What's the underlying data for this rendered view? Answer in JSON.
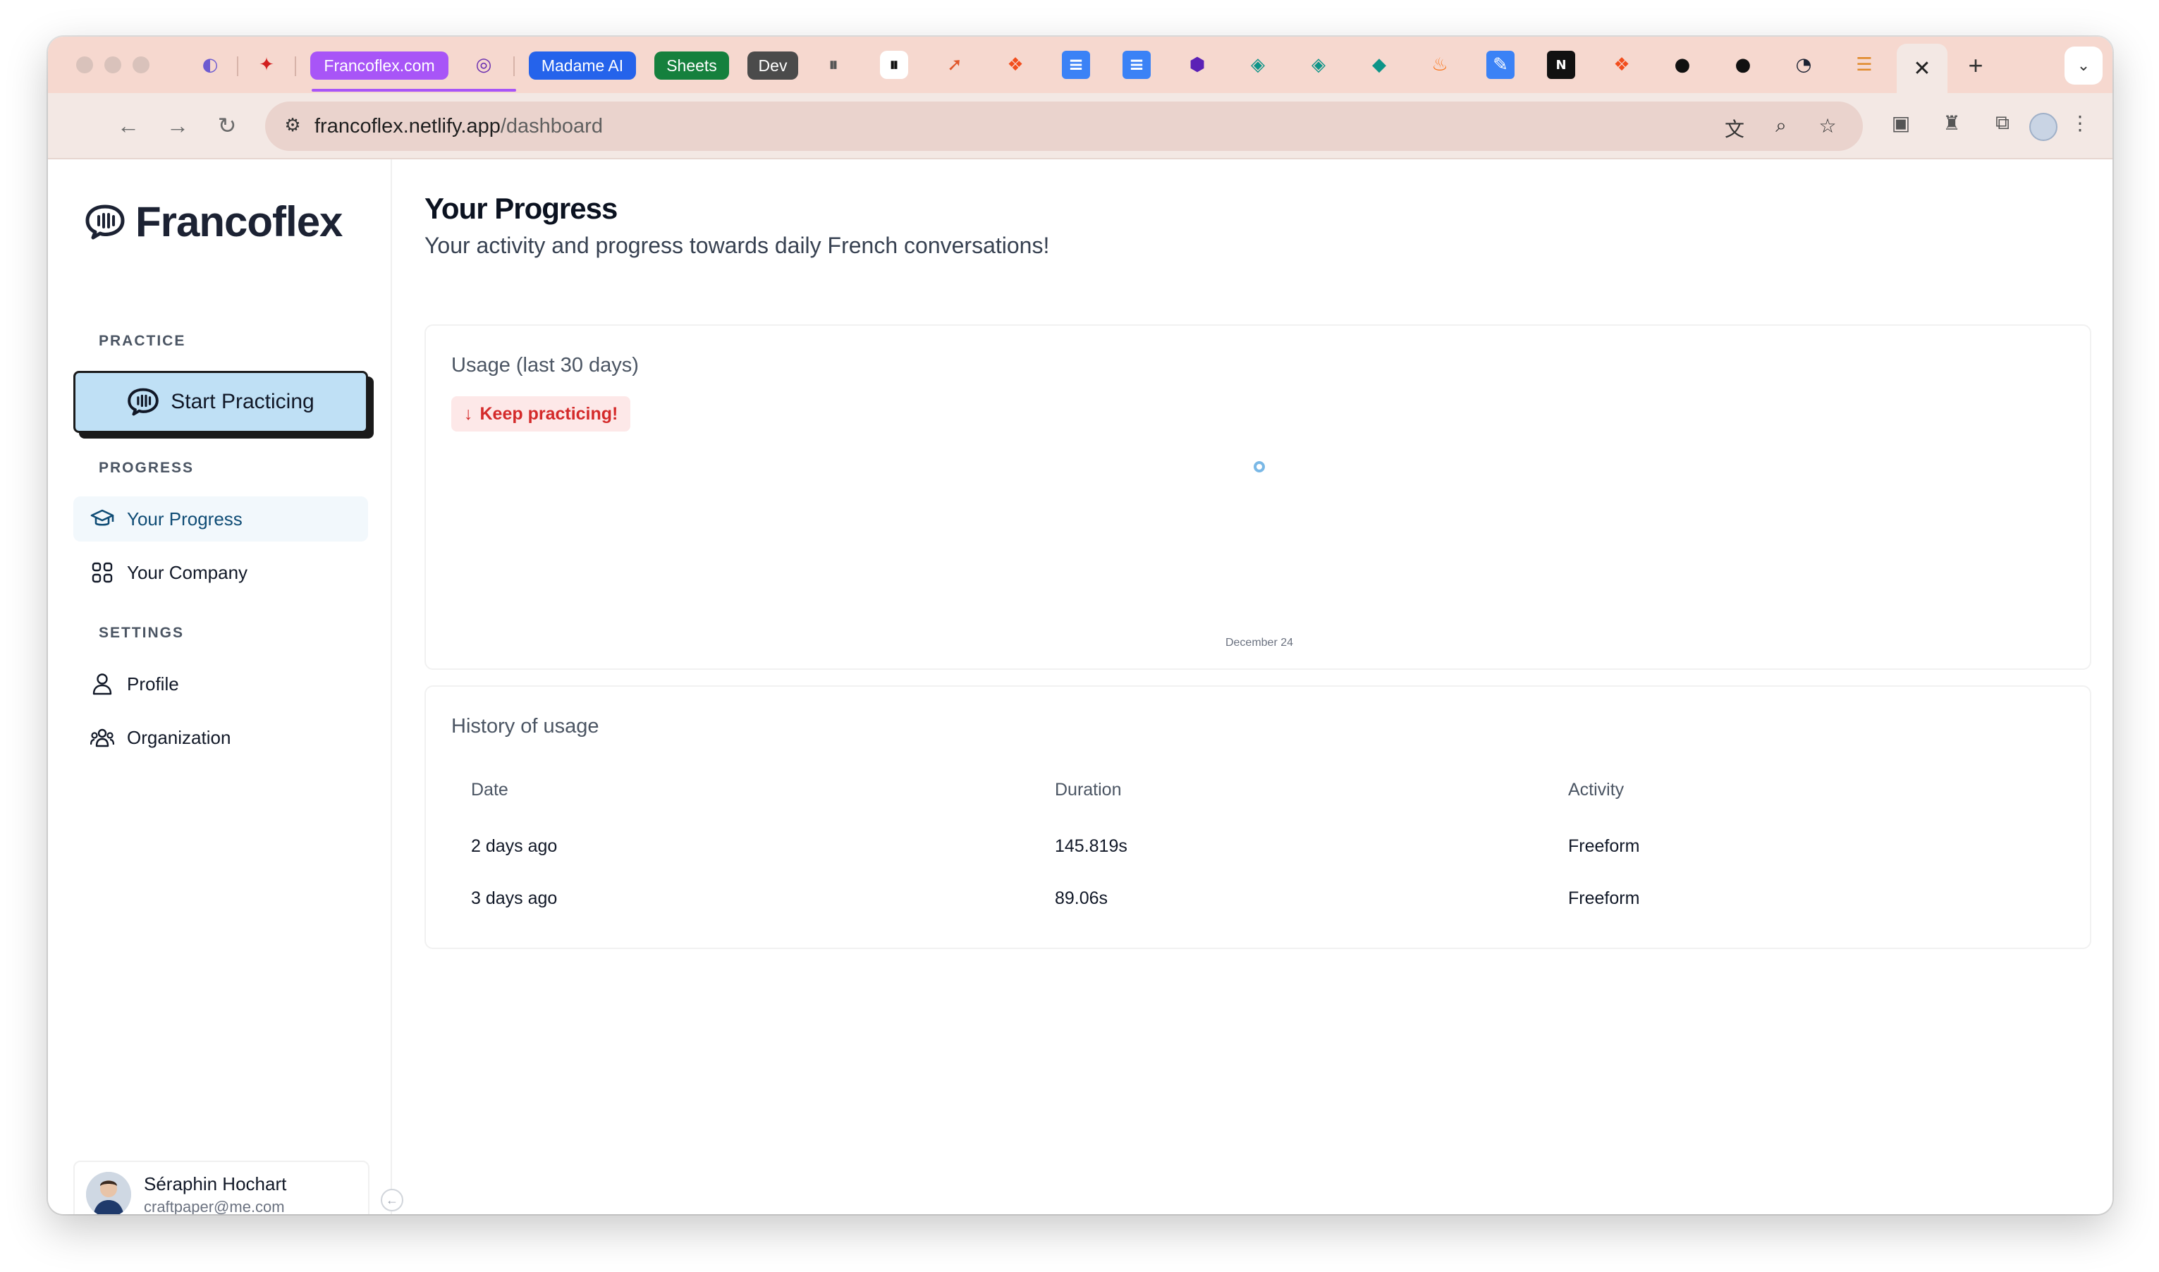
{
  "browser": {
    "tabs": {
      "francoflex": "Francoflex.com",
      "madame_ai": "Madame AI",
      "sheets": "Sheets",
      "dev": "Dev"
    },
    "url_host": "francoflex.netlify.app",
    "url_path": "/dashboard",
    "colors": {
      "tab_strip": "#f6d8cf",
      "francoflex_tab": "#a855f7",
      "madame_ai_tab": "#2563eb",
      "sheets_tab": "#15803d",
      "dev_tab": "#4b4b4b"
    }
  },
  "sidebar": {
    "brand": "Francoflex",
    "practice_label": "PRACTICE",
    "start_button": "Start Practicing",
    "progress_label": "PROGRESS",
    "progress_items": [
      {
        "label": "Your Progress",
        "active": true
      },
      {
        "label": "Your Company",
        "active": false
      }
    ],
    "settings_label": "SETTINGS",
    "settings_items": [
      {
        "label": "Profile"
      },
      {
        "label": "Organization"
      }
    ],
    "user": {
      "name": "Séraphin Hochart",
      "email": "craftpaper@me.com"
    }
  },
  "main": {
    "title": "Your Progress",
    "subtitle": "Your activity and progress towards daily French conversations!",
    "usage_card": {
      "title": "Usage (last 30 days)",
      "badge": "Keep practicing!"
    },
    "history_card": {
      "title": "History of usage",
      "columns": [
        "Date",
        "Duration",
        "Activity"
      ],
      "rows": [
        [
          "2 days ago",
          "145.819s",
          "Freeform"
        ],
        [
          "3 days ago",
          "89.06s",
          "Freeform"
        ]
      ]
    }
  },
  "chart_data": {
    "type": "line",
    "x": [
      "December 24"
    ],
    "series": [
      {
        "values": [
          235
        ]
      }
    ],
    "xlabel": "",
    "ylabel": "",
    "grid": false,
    "legend": "none",
    "point_color": "#7ab8e6"
  }
}
